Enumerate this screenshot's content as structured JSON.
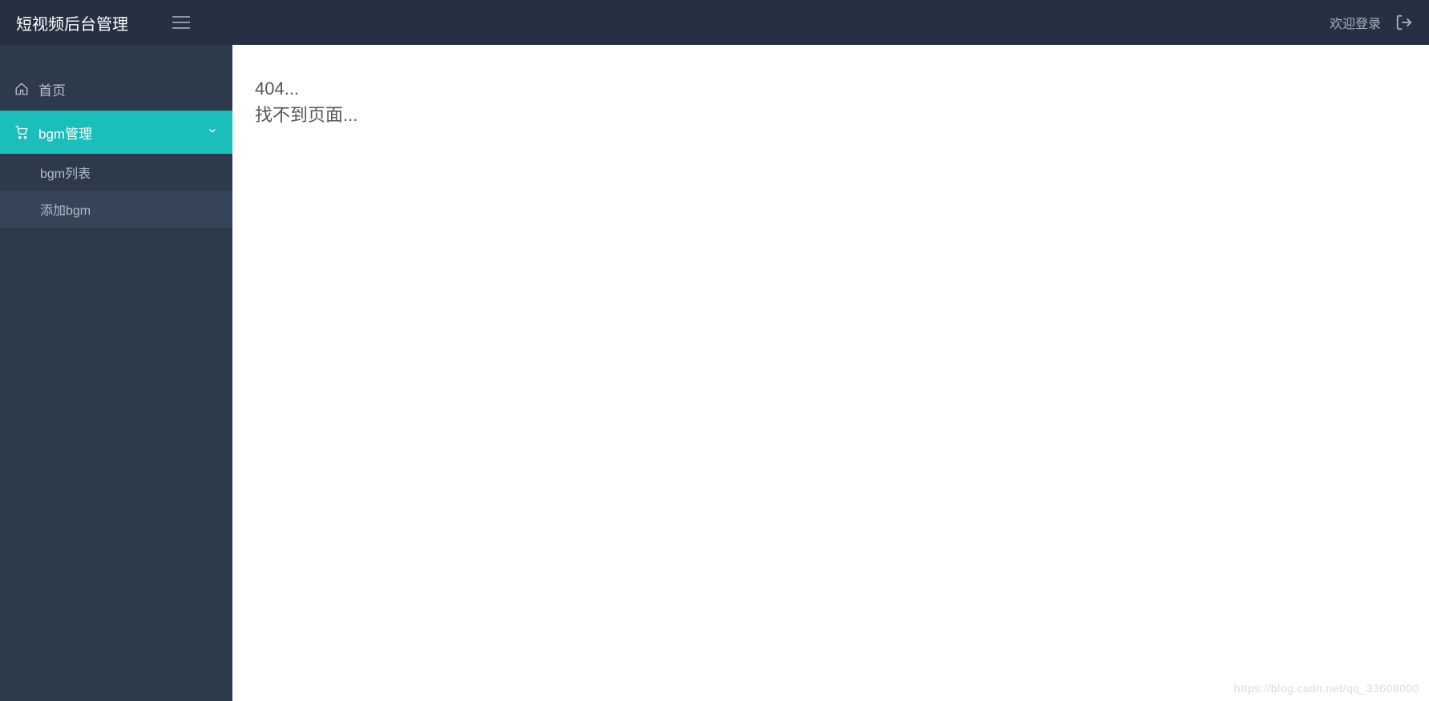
{
  "header": {
    "brand": "短视频后台管理",
    "welcome": "欢迎登录"
  },
  "sidebar": {
    "items": [
      {
        "label": "首页"
      },
      {
        "label": "bgm管理",
        "children": [
          {
            "label": "bgm列表"
          },
          {
            "label": "添加bgm"
          }
        ]
      }
    ]
  },
  "content": {
    "error_code": "404...",
    "error_msg": "找不到页面..."
  },
  "watermark": "https://blog.csdn.net/qq_33608000"
}
